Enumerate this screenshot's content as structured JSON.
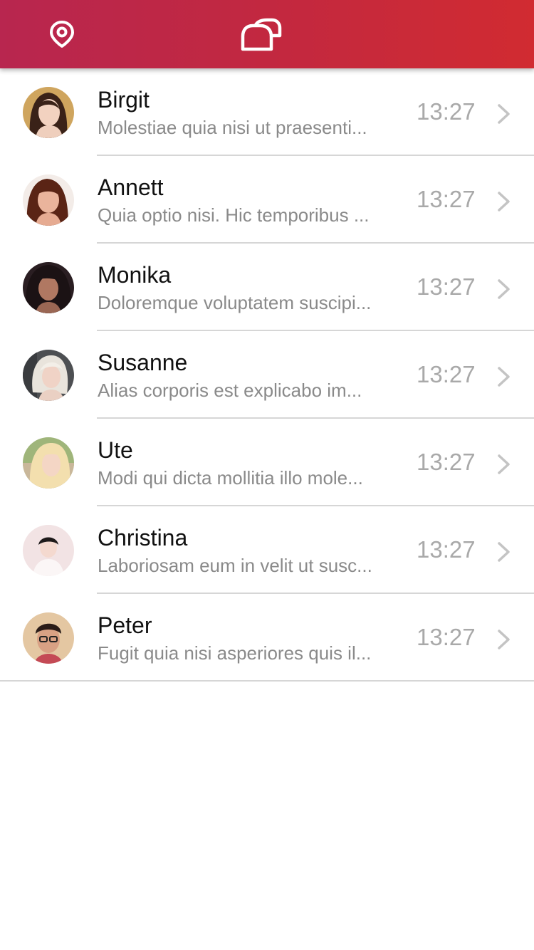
{
  "header": {
    "location_icon": "map-pin-icon",
    "chat_icon": "chat-bubbles-icon",
    "gradient_start": "#b8264f",
    "gradient_end": "#d12b31"
  },
  "conversations": [
    {
      "name": "Birgit",
      "preview": "Molestiae quia nisi ut praesenti...",
      "time": "13:27"
    },
    {
      "name": "Annett",
      "preview": "Quia optio nisi. Hic temporibus ...",
      "time": "13:27"
    },
    {
      "name": "Monika",
      "preview": "Doloremque voluptatem suscipi...",
      "time": "13:27"
    },
    {
      "name": "Susanne",
      "preview": "Alias corporis est explicabo im...",
      "time": "13:27"
    },
    {
      "name": "Ute",
      "preview": "Modi qui dicta mollitia illo mole...",
      "time": "13:27"
    },
    {
      "name": "Christina",
      "preview": "Laboriosam eum in velit ut susc...",
      "time": "13:27"
    },
    {
      "name": "Peter",
      "preview": "Fugit quia nisi asperiores quis il...",
      "time": "13:27"
    }
  ],
  "colors": {
    "name": "#111111",
    "preview": "#8a8a8a",
    "time": "#a9a9a9",
    "divider": "#d6d6d6"
  }
}
